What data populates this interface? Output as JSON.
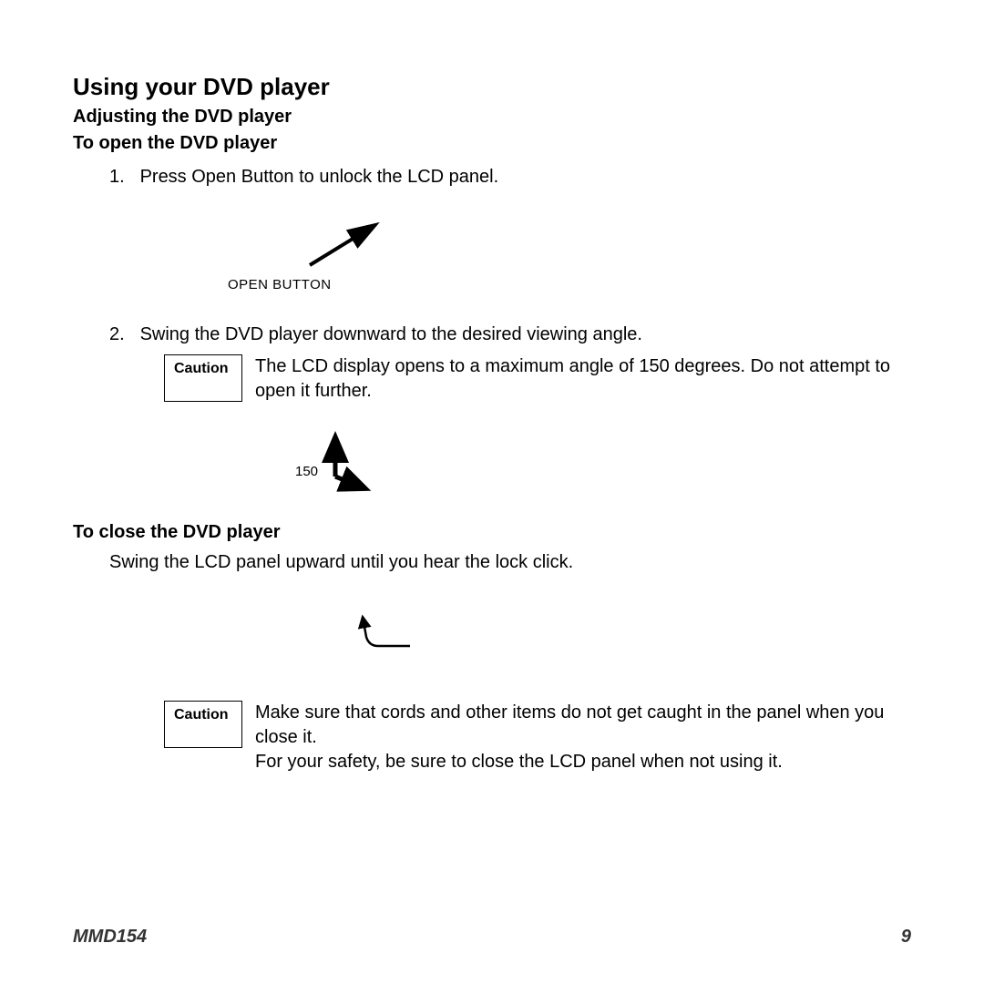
{
  "title": "Using your DVD player",
  "subtitle": "Adjusting the DVD player",
  "section_open": {
    "heading": "To open the DVD player",
    "step1_num": "1.",
    "step1_text": "Press Open Button to unlock the LCD panel.",
    "open_button_label": "OPEN BUTTON",
    "step2_num": "2.",
    "step2_text": "Swing the DVD player downward to the desired viewing angle.",
    "caution_label": "Caution",
    "caution_text": "The LCD display opens to a maximum angle of 150   degrees. Do not attempt to open it further.",
    "angle_value": "150"
  },
  "section_close": {
    "heading": "To close the DVD player",
    "body": "Swing the LCD panel upward until you hear the lock click.",
    "caution_label": "Caution",
    "caution_text": "Make sure that cords and other items do not get caught in the panel when you close it.\nFor your safety, be sure to close the LCD panel when not using it."
  },
  "footer": {
    "model": "MMD154",
    "page": "9"
  }
}
